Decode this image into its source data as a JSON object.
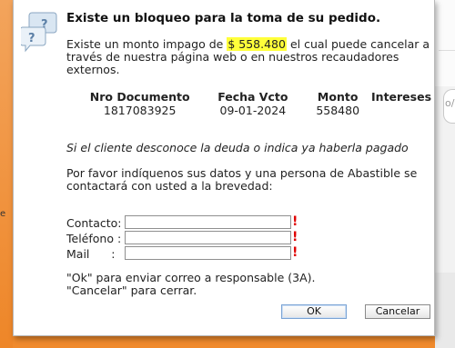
{
  "dialog": {
    "title": "Existe un bloqueo para la toma de su pedido.",
    "intro_before": "Existe un monto impago de ",
    "amount": "$ 558.480",
    "intro_after": " el cual puede cancelar a través de nuestra página web o en nuestros recaudadores externos.",
    "table": {
      "headers": [
        "Nro Documento",
        "Fecha Vcto",
        "Monto",
        "Intereses"
      ],
      "rows": [
        [
          "1817083925",
          "09-01-2024",
          "558480",
          ""
        ]
      ]
    },
    "italic_message": "Si el cliente desconoce la deuda o indica ya haberla pagado",
    "ask_message": "Por favor indíquenos sus datos y una persona de Abastible se contactará con usted a la brevedad:",
    "form": {
      "contact_label": "Contacto:",
      "phone_label": "Teléfono :",
      "mail_label": "Mail      :",
      "contact_value": "",
      "phone_value": "",
      "mail_value": "",
      "required_mark": "!"
    },
    "footer_line1": "\"Ok\" para enviar correo a responsable (3A).",
    "footer_line2": "\"Cancelar\" para cerrar.",
    "ok_label": "OK",
    "cancel_label": "Cancelar"
  },
  "background": {
    "right_field_text": "o/o",
    "left_text": "e"
  },
  "colors": {
    "highlight": "#ffff3a",
    "required": "#e00000",
    "page_orange": "#f08a2c"
  },
  "icons": {
    "dialog": "question-bubbles-icon"
  }
}
